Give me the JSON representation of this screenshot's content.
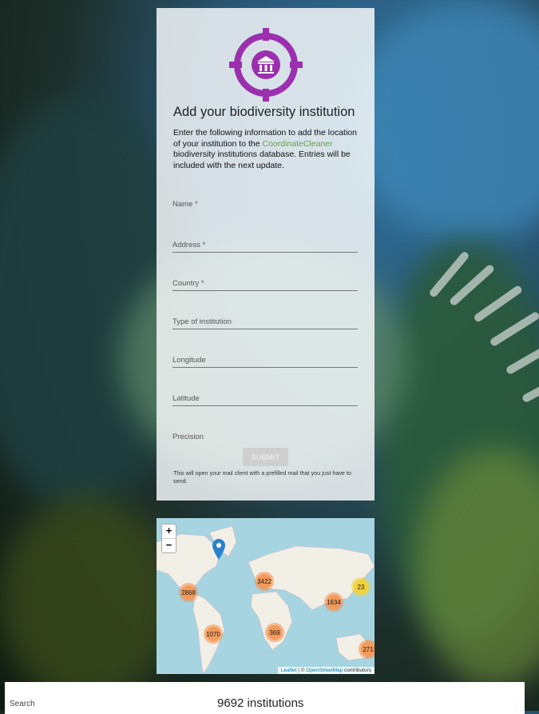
{
  "form": {
    "title": "Add your biodiversity institution",
    "intro_before": "Enter the following information to add the location of your institution to the ",
    "intro_link": "CoordinateCleaner",
    "intro_after": " biodiversity institutions database. Entries will be included with the next update.",
    "fields": {
      "name": "Name *",
      "address": "Address *",
      "country": "Country *",
      "type": "Type of institution",
      "longitude": "Longitude",
      "latitude": "Latitude",
      "precision": "Precision"
    },
    "submit_label": "SUBMIT",
    "note": "This will open your mail client with a prefilled mail that you just have to send."
  },
  "map": {
    "zoom_in": "+",
    "zoom_out": "−",
    "clusters": [
      "2868",
      "3422",
      "1634",
      "23",
      "1070",
      "369",
      "271"
    ],
    "attribution_leaflet": "Leaflet",
    "attribution_sep": " | © ",
    "attribution_osm": "OpenStreetMap",
    "attribution_tail": " contributors"
  },
  "footer": {
    "search_label": "Search",
    "count": "9692 institutions"
  },
  "colors": {
    "logo": "#9b2fae",
    "link": "#6aa04a",
    "cluster": "#f39a5a",
    "cluster_small": "#f2d23c",
    "water": "#a6d4e0"
  }
}
